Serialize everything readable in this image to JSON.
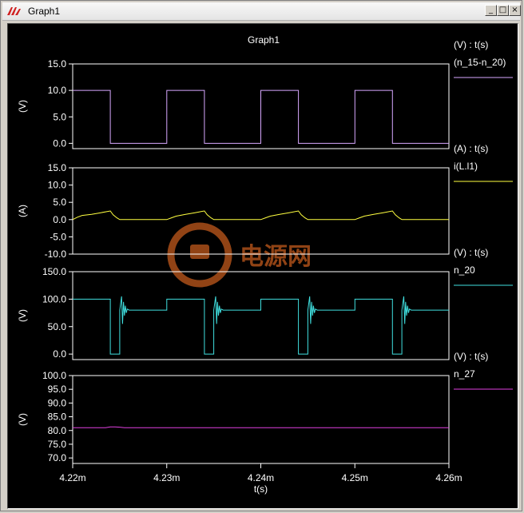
{
  "window": {
    "title": "Graph1",
    "minimize_glyph": "_",
    "maximize_glyph": "□",
    "close_glyph": "×"
  },
  "graph": {
    "title": "Graph1"
  },
  "watermark": {
    "text": "电源网"
  },
  "colors": {
    "background": "#000000",
    "frame": "#ffffff",
    "text": "#ffffff",
    "watermark": "#c25a1c"
  },
  "chart_data": [
    {
      "type": "line",
      "legend_header": "(V) : t(s)",
      "ylabel": "(V)",
      "ylim": [
        -1.0,
        15.0
      ],
      "yticks": [
        "15.0",
        "10.0",
        "5.0",
        "0.0"
      ],
      "ytick_values": [
        15.0,
        10.0,
        5.0,
        0.0
      ],
      "series": [
        {
          "name": "(n_15-n_20)",
          "color": "#d8a8ff",
          "x": [
            4.22,
            4.22,
            4.224,
            4.224,
            4.23,
            4.23,
            4.234,
            4.234,
            4.24,
            4.24,
            4.244,
            4.244,
            4.25,
            4.25,
            4.254,
            4.254,
            4.26
          ],
          "y": [
            10,
            10,
            10,
            0,
            0,
            10,
            10,
            0,
            0,
            10,
            10,
            0,
            0,
            10,
            10,
            0,
            0
          ]
        }
      ]
    },
    {
      "type": "line",
      "legend_header": "(A) : t(s)",
      "ylabel": "(A)",
      "ylim": [
        -10.0,
        15.0
      ],
      "yticks": [
        "15.0",
        "10.0",
        "5.0",
        "0.0",
        "-5.0",
        "-10.0"
      ],
      "ytick_values": [
        15.0,
        10.0,
        5.0,
        0.0,
        -5.0,
        -10.0
      ],
      "series": [
        {
          "name": "i(L.l1)",
          "color": "#ffff40",
          "x": [
            4.22,
            4.2205,
            4.221,
            4.222,
            4.223,
            4.224,
            4.2243,
            4.2247,
            4.225,
            4.23,
            4.2305,
            4.231,
            4.232,
            4.233,
            4.234,
            4.2343,
            4.2347,
            4.235,
            4.24,
            4.2405,
            4.241,
            4.242,
            4.243,
            4.244,
            4.2443,
            4.2447,
            4.245,
            4.25,
            4.2505,
            4.251,
            4.252,
            4.253,
            4.254,
            4.2543,
            4.2547,
            4.255,
            4.26
          ],
          "y": [
            0,
            0.7,
            1.2,
            1.5,
            2.0,
            2.5,
            1.4,
            0.5,
            0,
            0,
            0.5,
            1.0,
            1.5,
            2.0,
            2.5,
            1.4,
            0.5,
            0,
            0,
            0.5,
            1.0,
            1.5,
            2.0,
            2.5,
            1.4,
            0.5,
            0,
            0,
            0.5,
            1.0,
            1.5,
            2.0,
            2.5,
            1.4,
            0.5,
            0,
            0
          ]
        }
      ]
    },
    {
      "type": "line",
      "legend_header": "(V) : t(s)",
      "ylabel": "(V)",
      "ylim": [
        -10.0,
        150.0
      ],
      "yticks": [
        "150.0",
        "100.0",
        "50.0",
        "0.0"
      ],
      "ytick_values": [
        150.0,
        100.0,
        50.0,
        0.0
      ],
      "series": [
        {
          "name": "n_20",
          "color": "#40e0e0",
          "x": [
            4.22,
            4.224,
            4.224,
            4.225,
            4.225,
            4.2252,
            4.2253,
            4.2254,
            4.2255,
            4.2256,
            4.2257,
            4.2258,
            4.226,
            4.23,
            4.23,
            4.234,
            4.234,
            4.235,
            4.235,
            4.2352,
            4.2353,
            4.2354,
            4.2355,
            4.2356,
            4.2357,
            4.2358,
            4.236,
            4.24,
            4.24,
            4.244,
            4.244,
            4.245,
            4.245,
            4.2452,
            4.2453,
            4.2454,
            4.2455,
            4.2456,
            4.2457,
            4.2458,
            4.246,
            4.25,
            4.25,
            4.254,
            4.254,
            4.255,
            4.255,
            4.2552,
            4.2553,
            4.2554,
            4.2555,
            4.2556,
            4.2557,
            4.2558,
            4.256,
            4.26
          ],
          "y": [
            100,
            100,
            0,
            0,
            80,
            105,
            55,
            95,
            70,
            88,
            75,
            82,
            80,
            80,
            100,
            100,
            0,
            0,
            80,
            105,
            55,
            95,
            70,
            88,
            75,
            82,
            80,
            80,
            100,
            100,
            0,
            0,
            80,
            105,
            55,
            95,
            70,
            88,
            75,
            82,
            80,
            80,
            100,
            100,
            0,
            0,
            80,
            105,
            55,
            95,
            70,
            88,
            75,
            82,
            80,
            80
          ]
        }
      ]
    },
    {
      "type": "line",
      "legend_header": "(V) : t(s)",
      "ylabel": "(V)",
      "ylim": [
        68.0,
        100.0
      ],
      "yticks": [
        "100.0",
        "95.0",
        "90.0",
        "85.0",
        "80.0",
        "75.0",
        "70.0"
      ],
      "ytick_values": [
        100.0,
        95.0,
        90.0,
        85.0,
        80.0,
        75.0,
        70.0
      ],
      "xlabel": "t(s)",
      "xticks": [
        "4.22m",
        "4.23m",
        "4.24m",
        "4.25m",
        "4.26m"
      ],
      "xtick_values": [
        4.22,
        4.23,
        4.24,
        4.25,
        4.26
      ],
      "series": [
        {
          "name": "n_27",
          "color": "#e040e0",
          "x": [
            4.22,
            4.2235,
            4.224,
            4.2245,
            4.225,
            4.2255,
            4.26
          ],
          "y": [
            81.0,
            81.0,
            81.3,
            81.3,
            81.2,
            81.0,
            81.0
          ]
        }
      ]
    }
  ]
}
